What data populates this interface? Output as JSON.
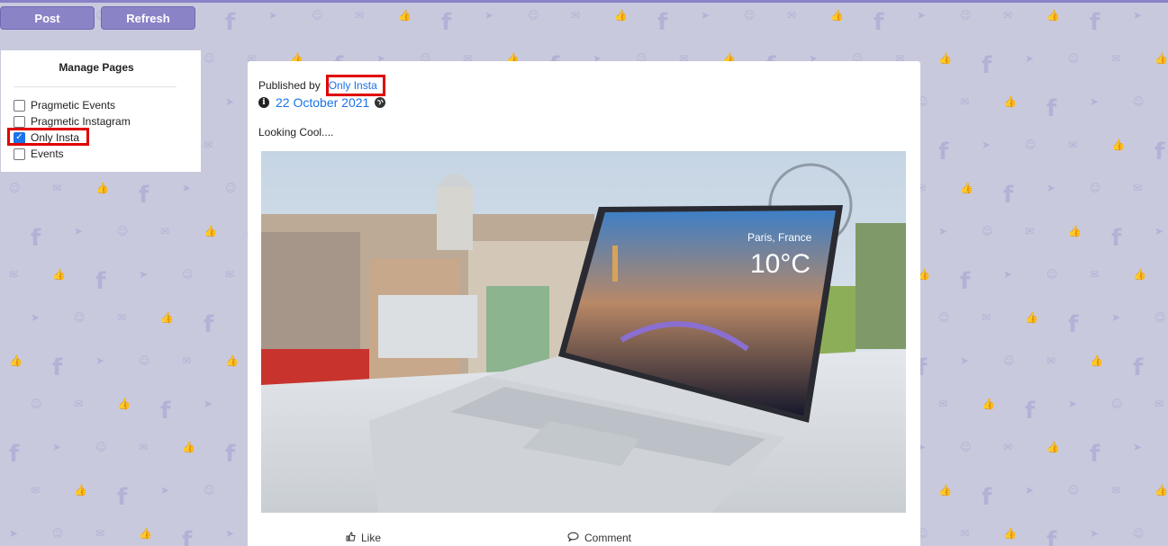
{
  "toolbar": {
    "post_label": "Post",
    "refresh_label": "Refresh"
  },
  "manage_pages": {
    "title": "Manage Pages",
    "pages": [
      {
        "label": "Pragmetic Events",
        "checked": false
      },
      {
        "label": "Pragmetic Instagram",
        "checked": false
      },
      {
        "label": "Only Insta",
        "checked": true
      },
      {
        "label": "Events",
        "checked": false
      }
    ]
  },
  "post": {
    "published_by_label": "Published by",
    "publisher": "Only Insta",
    "date": "22 October 2021",
    "caption": "Looking Cool....",
    "image_overlay": {
      "city": "Paris, France",
      "temperature": "10°C"
    },
    "actions": {
      "like_label": "Like",
      "comment_label": "Comment"
    }
  },
  "colors": {
    "accent": "#1a73e8",
    "button": "#8a84c6",
    "highlight": "#e00000",
    "background": "#c9c9dd"
  }
}
